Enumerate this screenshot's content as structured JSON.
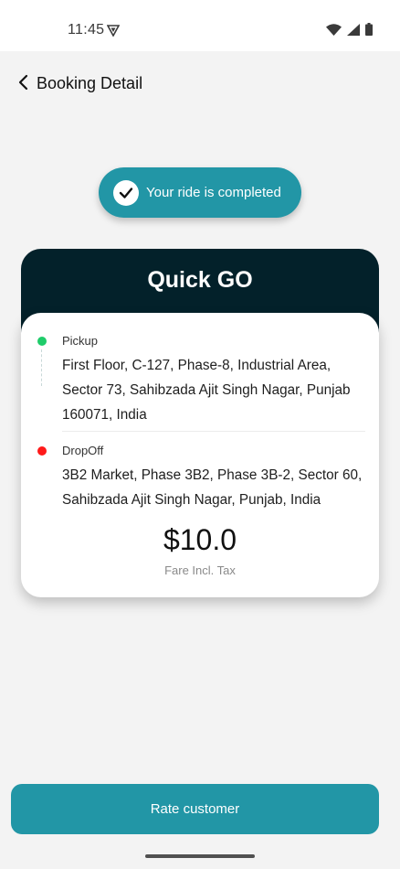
{
  "status_bar": {
    "time": "11:45",
    "icons": [
      "vpn-icon",
      "wifi-icon",
      "signal-icon",
      "battery-icon"
    ]
  },
  "header": {
    "title": "Booking Detail",
    "back_icon": "chevron-left-icon"
  },
  "ride_status": {
    "text": "Your ride is completed",
    "icon": "check-icon",
    "color": "#2296a6"
  },
  "card": {
    "title": "Quick GO",
    "header_color": "#03212a",
    "pickup": {
      "label": "Pickup",
      "address": "First Floor, C-127, Phase-8, Industrial Area, Sector 73, Sahibzada Ajit Singh Nagar, Punjab 160071, India",
      "dot_color": "#1fcc6a"
    },
    "dropoff": {
      "label": "DropOff",
      "address": "3B2 Market, Phase 3B2, Phase 3B-2, Sector 60, Sahibzada Ajit Singh Nagar, Punjab, India",
      "dot_color": "#ff1a1a"
    },
    "fare": {
      "amount": "$10.0",
      "caption": "Fare Incl. Tax"
    }
  },
  "actions": {
    "rate_label": "Rate customer"
  }
}
